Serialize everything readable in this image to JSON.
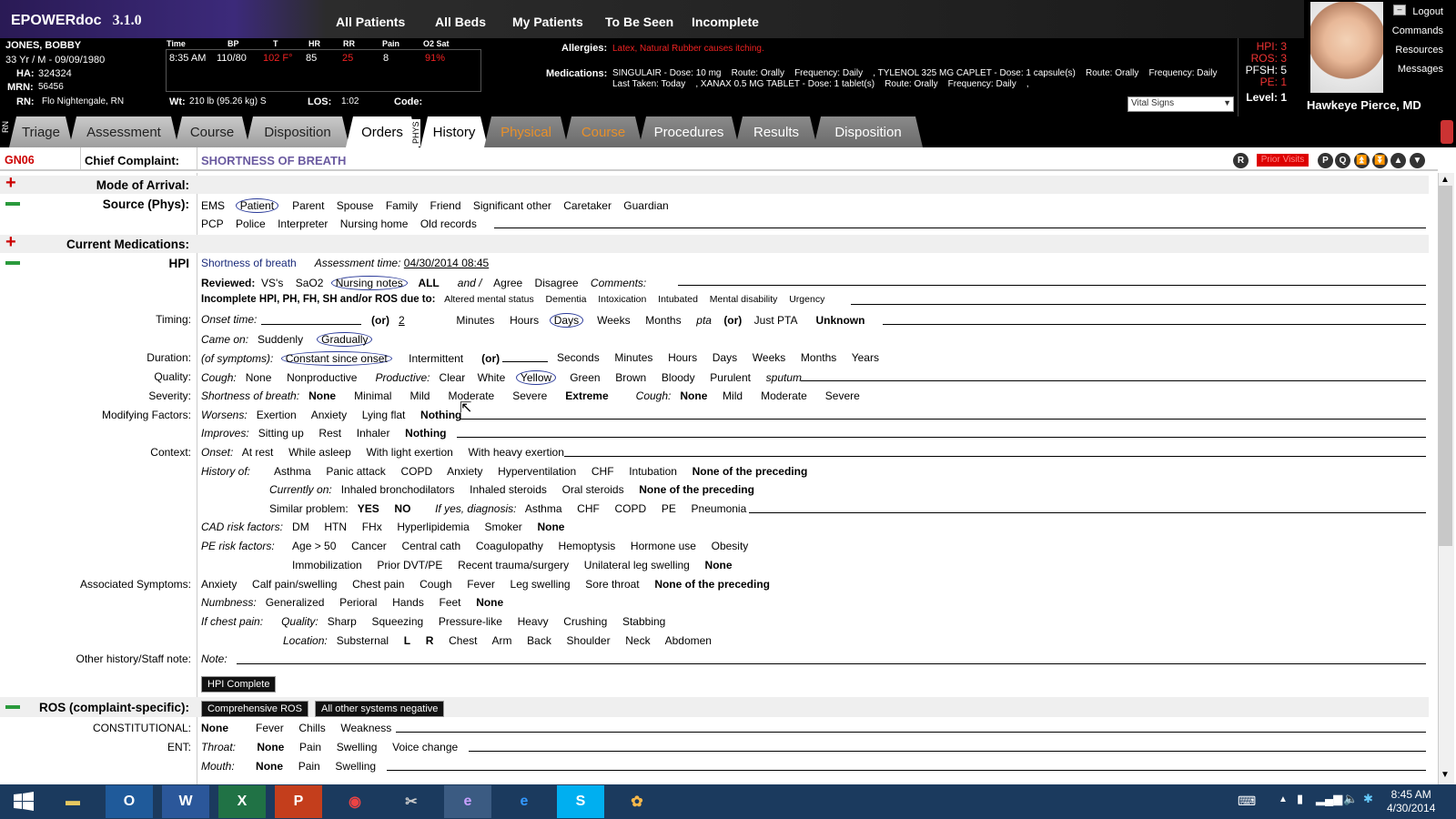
{
  "app": {
    "name": "EPOWERdoc",
    "version": "3.1.0"
  },
  "topnav": [
    "All Patients",
    "All Beds",
    "My Patients",
    "To Be Seen",
    "Incomplete"
  ],
  "patient": {
    "name": "JONES, BOBBY",
    "agesex": "33 Yr / M  -  09/09/1980",
    "ha_label": "HA:",
    "ha": "324324",
    "mrn_label": "MRN:",
    "mrn": "56456",
    "rn_label": "RN:",
    "rn": "Flo Nightengale, RN"
  },
  "vitals": {
    "headers": [
      "Time",
      "BP",
      "T",
      "HR",
      "RR",
      "Pain",
      "O2 Sat"
    ],
    "values": [
      "8:35 AM",
      "110/80",
      "102 F°",
      "85",
      "25",
      "8",
      "91%"
    ],
    "wt_label": "Wt:",
    "wt": "210 lb (95.26 kg) S",
    "los_label": "LOS:",
    "los": "1:02",
    "code_label": "Code:"
  },
  "allergies": {
    "label": "Allergies:",
    "text": "Latex, Natural Rubber causes itching."
  },
  "medications": {
    "label": "Medications:",
    "line1": "SINGULAIR - Dose: 10 mg    Route: Orally    Frequency: Daily    , TYLENOL 325 MG CAPLET - Dose: 1 capsule(s)    Route: Orally    Frequency: Daily",
    "line2": "Last Taken: Today    , XANAX 0.5 MG TABLET - Dose: 1 tablet(s)    Route: Orally    Frequency: Daily    ,"
  },
  "flags": {
    "hpi": "HPI: 3",
    "ros": "ROS: 3",
    "pfsh": "PFSH: 5",
    "pe": "PE: 1",
    "level": "Level: 1"
  },
  "vital_select": "Vital Signs",
  "right_menu": [
    "Logout",
    "Commands",
    "Resources",
    "Messages"
  ],
  "doctor": "Hawkeye Pierce, MD",
  "rn_tabs": [
    "Triage",
    "Assessment",
    "Course",
    "Disposition",
    "Orders"
  ],
  "phys_tabs": [
    "History",
    "Physical",
    "Course",
    "Procedures",
    "Results",
    "Disposition"
  ],
  "vt_rn": "RN",
  "vt_phys": "PHYS",
  "cc": {
    "code": "GN06",
    "label": "Chief Complaint:",
    "value": "SHORTNESS OF BREATH",
    "prior": "Prior Visits",
    "icons": [
      "R",
      "P",
      "Q"
    ]
  },
  "form": {
    "mode": "Mode of Arrival:",
    "source": "Source (Phys):",
    "source_opts1": [
      "EMS",
      "Patient",
      "Parent",
      "Spouse",
      "Family",
      "Friend",
      "Significant other",
      "Caretaker",
      "Guardian"
    ],
    "source_opts2": [
      "PCP",
      "Police",
      "Interpreter",
      "Nursing home",
      "Old records"
    ],
    "curmeds": "Current Medications:",
    "hpi": "HPI",
    "sob": "Shortness of breath",
    "assess_lbl": "Assessment time:",
    "assess_time": "04/30/2014 08:45",
    "reviewed": "Reviewed:",
    "rev_opts": [
      "VS's",
      "SaO2",
      "Nursing notes",
      "ALL",
      "and /",
      "Agree",
      "Disagree",
      "Comments:"
    ],
    "incomplete": "Incomplete HPI, PH, FH, SH and/or ROS due to:",
    "inc_opts": [
      "Altered mental status",
      "Dementia",
      "Intoxication",
      "Intubated",
      "Mental disability",
      "Urgency"
    ],
    "timing": "Timing:",
    "onset": "Onset time:",
    "or": "(or)",
    "onset_num": "2",
    "timing_opts": [
      "Minutes",
      "Hours",
      "Days",
      "Weeks",
      "Months"
    ],
    "pta": "pta",
    "justpta": "Just PTA",
    "unknown": "Unknown",
    "came": "Came on:",
    "came_opts": [
      "Suddenly",
      "Gradually"
    ],
    "duration": "Duration:",
    "ofsym": "(of symptoms):",
    "dur_opts": [
      "Constant since onset",
      "Intermittent"
    ],
    "dur_units": [
      "Seconds",
      "Minutes",
      "Hours",
      "Days",
      "Weeks",
      "Months",
      "Years"
    ],
    "quality": "Quality:",
    "cough": "Cough:",
    "q_opts": [
      "None",
      "Nonproductive"
    ],
    "productive": "Productive:",
    "prod_opts": [
      "Clear",
      "White",
      "Yellow",
      "Green",
      "Brown",
      "Bloody",
      "Purulent"
    ],
    "sputum": "sputum",
    "severity": "Severity:",
    "sobl": "Shortness of breath:",
    "sev_opts": [
      "None",
      "Minimal",
      "Mild",
      "Moderate",
      "Severe",
      "Extreme"
    ],
    "cough2": "Cough:",
    "csev": [
      "None",
      "Mild",
      "Moderate",
      "Severe"
    ],
    "modifying": "Modifying Factors:",
    "worsens": "Worsens:",
    "wor_opts": [
      "Exertion",
      "Anxiety",
      "Lying flat",
      "Nothing"
    ],
    "improves": "Improves:",
    "imp_opts": [
      "Sitting up",
      "Rest",
      "Inhaler",
      "Nothing"
    ],
    "context": "Context:",
    "onset2": "Onset:",
    "ctx_opts": [
      "At rest",
      "While asleep",
      "With light exertion",
      "With heavy exertion"
    ],
    "histof": "History of:",
    "hist_opts": [
      "Asthma",
      "Panic attack",
      "COPD",
      "Anxiety",
      "Hyperventilation",
      "CHF",
      "Intubation",
      "None of the preceding"
    ],
    "curon": "Currently on:",
    "curon_opts": [
      "Inhaled bronchodilators",
      "Inhaled steroids",
      "Oral steroids",
      "None of the preceding"
    ],
    "similar": "Similar problem:",
    "yes": "YES",
    "no": "NO",
    "ifyes": "If yes, diagnosis:",
    "diag_opts": [
      "Asthma",
      "CHF",
      "COPD",
      "PE",
      "Pneumonia"
    ],
    "cad": "CAD risk factors:",
    "cad_opts": [
      "DM",
      "HTN",
      "FHx",
      "Hyperlipidemia",
      "Smoker",
      "None"
    ],
    "pe": "PE risk factors:",
    "pe_opts1": [
      "Age > 50",
      "Cancer",
      "Central cath",
      "Coagulopathy",
      "Hemoptysis",
      "Hormone use",
      "Obesity"
    ],
    "pe_opts2": [
      "Immobilization",
      "Prior DVT/PE",
      "Recent trauma/surgery",
      "Unilateral leg swelling",
      "None"
    ],
    "assoc": "Associated Symptoms:",
    "assoc_opts": [
      "Anxiety",
      "Calf pain/swelling",
      "Chest pain",
      "Cough",
      "Fever",
      "Leg swelling",
      "Sore throat",
      "None of the preceding"
    ],
    "numb": "Numbness:",
    "numb_opts": [
      "Generalized",
      "Perioral",
      "Hands",
      "Feet",
      "None"
    ],
    "ifchest": "If chest pain:",
    "cq": "Quality:",
    "cq_opts": [
      "Sharp",
      "Squeezing",
      "Pressure-like",
      "Heavy",
      "Crushing",
      "Stabbing"
    ],
    "loc": "Location:",
    "loc_opts": [
      "Substernal",
      "L",
      "R",
      "Chest",
      "Arm",
      "Back",
      "Shoulder",
      "Neck",
      "Abdomen"
    ],
    "other": "Other history/Staff note:",
    "note": "Note:",
    "hpicomplete": "HPI Complete",
    "ros": "ROS (complaint-specific):",
    "comp_ros": "Comprehensive ROS",
    "allneg": "All other systems negative",
    "const": "CONSTITUTIONAL:",
    "const_opts": [
      "None",
      "Fever",
      "Chills",
      "Weakness"
    ],
    "ent": "ENT:",
    "throat": "Throat:",
    "throat_opts": [
      "None",
      "Pain",
      "Swelling",
      "Voice change"
    ],
    "mouth": "Mouth:",
    "mouth_opts": [
      "None",
      "Pain",
      "Swelling"
    ]
  },
  "taskbar": {
    "time": "8:45 AM",
    "date": "4/30/2014"
  }
}
